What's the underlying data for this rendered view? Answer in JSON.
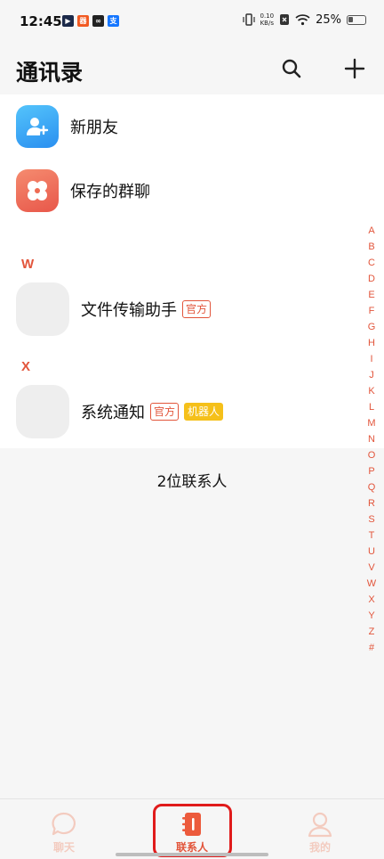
{
  "status_bar": {
    "time": "12:45",
    "net_speed_value": "0.10",
    "net_speed_unit": "KB/s",
    "battery": "25%",
    "app_icons": [
      "play-icon",
      "shop-icon",
      "link-icon",
      "alipay-icon"
    ]
  },
  "header": {
    "title": "通讯录",
    "search_icon": "search-icon",
    "add_icon": "plus-icon"
  },
  "top_items": [
    {
      "label": "新朋友",
      "icon": "add-user-icon",
      "color": "#36a6f2"
    },
    {
      "label": "保存的群聊",
      "icon": "group-chat-icon",
      "color": "#ee6b53"
    }
  ],
  "sections": [
    {
      "letter": "W",
      "contacts": [
        {
          "name": "文件传输助手",
          "tags": [
            "官方"
          ]
        }
      ]
    },
    {
      "letter": "X",
      "contacts": [
        {
          "name": "系统通知",
          "tags": [
            "官方",
            "机器人"
          ]
        }
      ]
    }
  ],
  "contact_count": "2位联系人",
  "alphabet": [
    "A",
    "B",
    "C",
    "D",
    "E",
    "F",
    "G",
    "H",
    "I",
    "J",
    "K",
    "L",
    "M",
    "N",
    "O",
    "P",
    "Q",
    "R",
    "S",
    "T",
    "U",
    "V",
    "W",
    "X",
    "Y",
    "Z",
    "#"
  ],
  "bottom_nav": [
    {
      "label": "聊天",
      "icon": "chat-icon",
      "active": false
    },
    {
      "label": "联系人",
      "icon": "contacts-icon",
      "active": true
    },
    {
      "label": "我的",
      "icon": "profile-icon",
      "active": false
    }
  ],
  "colors": {
    "accent": "#e2553b",
    "inactive_nav": "#f3cbbf",
    "tag_yellow": "#f5c01a",
    "annotation_box": "#e01b1b"
  }
}
